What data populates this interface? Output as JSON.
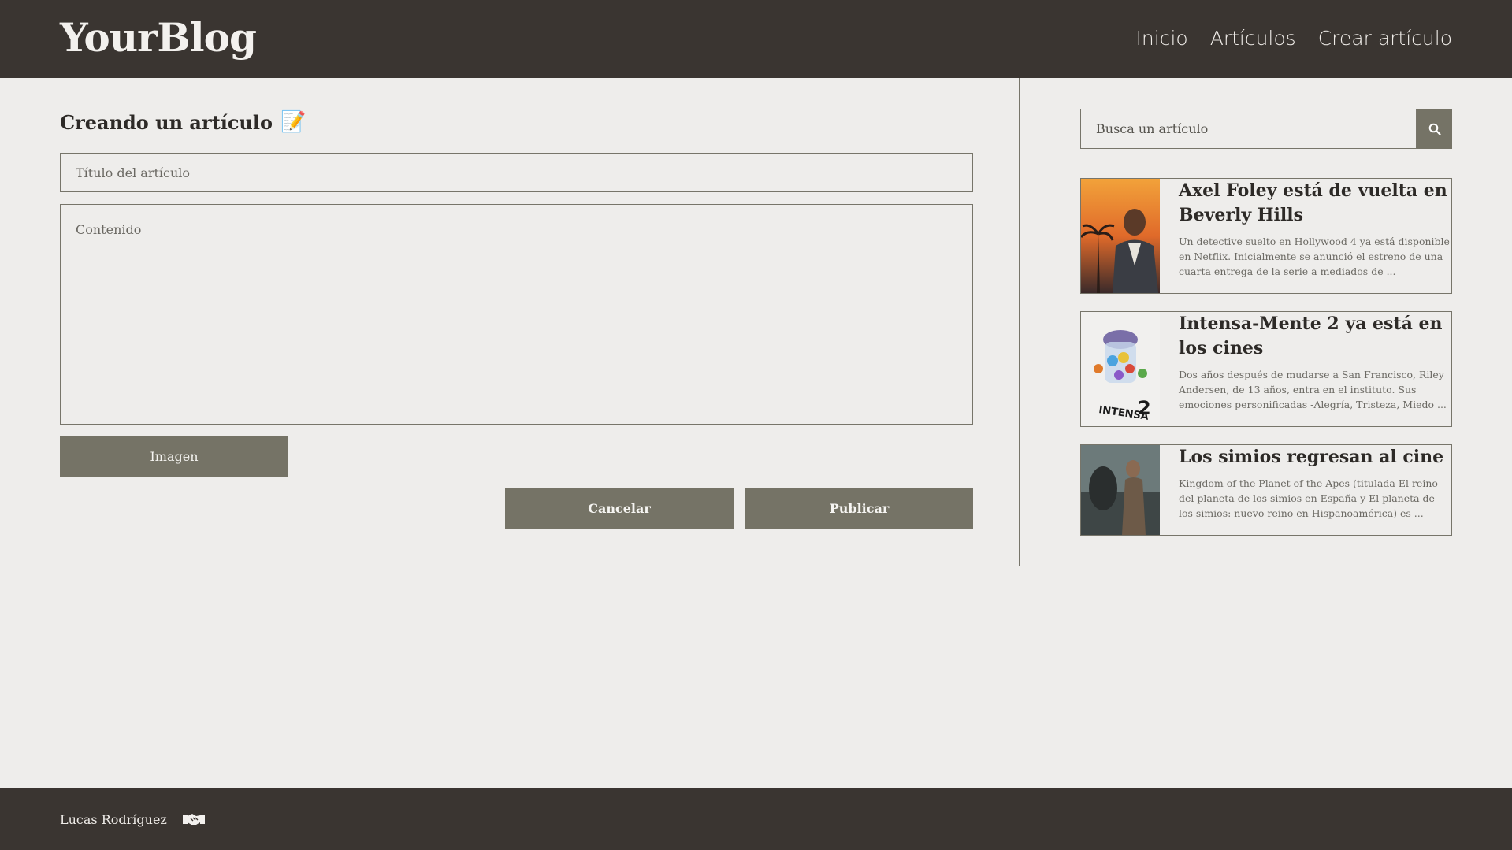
{
  "header": {
    "logo": "YourBlog",
    "nav": [
      "Inicio",
      "Artículos",
      "Crear artículo"
    ]
  },
  "main": {
    "title": "Creando un artículo",
    "title_icon": "📝",
    "title_placeholder": "Título del artículo",
    "content_placeholder": "Contenido",
    "image_button": "Imagen",
    "cancel_button": "Cancelar",
    "publish_button": "Publicar"
  },
  "sidebar": {
    "search_placeholder": "Busca un artículo",
    "search_icon": "search-icon",
    "articles": [
      {
        "title": "Axel Foley está de vuelta en Beverly Hills",
        "excerpt": "Un detective suelto en Hollywood 4 ya está disponible en Netflix. Inicialmente se anunció el estreno de una cuarta entrega de la serie a mediados de ..."
      },
      {
        "title": "Intensa-Mente 2 ya está en los cines",
        "excerpt": "Dos años después de mudarse a San Francisco, Riley Andersen, de 13 años, entra en el instituto. Sus emociones personificadas -Alegría, Tristeza, Miedo ..."
      },
      {
        "title": "Los simios regresan al cine",
        "excerpt": "Kingdom of the Planet of the Apes (titulada El reino del planeta de los simios en España y El planeta de los simios: nuevo reino en Hispanoamérica) es ..."
      }
    ]
  },
  "footer": {
    "author": "Lucas Rodríguez",
    "icon": "handshake-icon"
  },
  "colors": {
    "header_bg": "#3a3531",
    "page_bg": "#eeedeb",
    "button_bg": "#757366"
  }
}
